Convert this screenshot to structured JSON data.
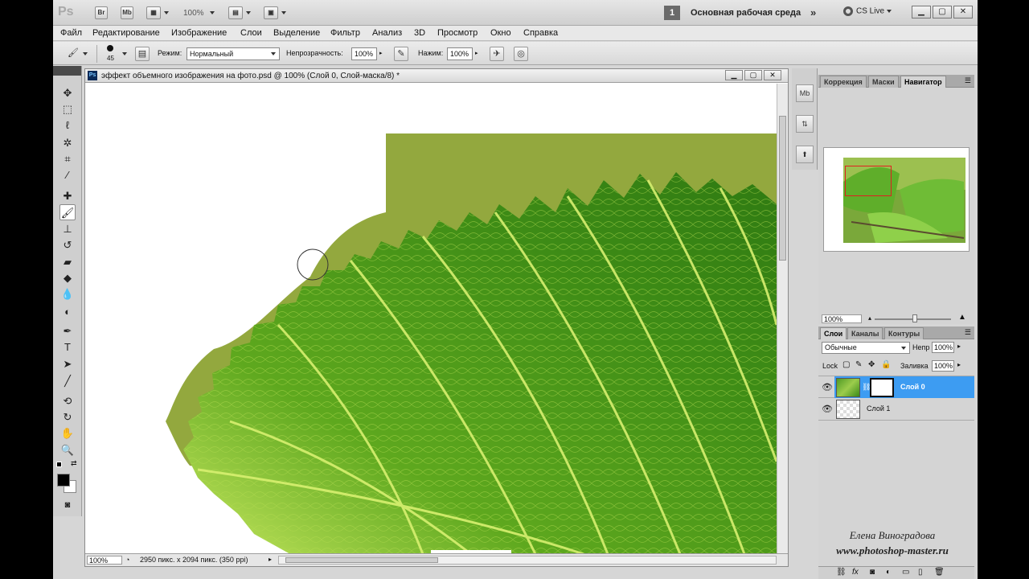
{
  "app": {
    "logo": "Ps",
    "bridge_btn": "Br",
    "minibridge_btn": "Mb",
    "zoom": "100%",
    "workspace_number": "1",
    "workspace": "Основная рабочая среда",
    "cs_live": "CS Live"
  },
  "menu": [
    "Файл",
    "Редактирование",
    "Изображение",
    "Слои",
    "Выделение",
    "Фильтр",
    "Анализ",
    "3D",
    "Просмотр",
    "Окно",
    "Справка"
  ],
  "options": {
    "brush_size": "45",
    "mode_label": "Режим:",
    "mode_value": "Нормальный",
    "opacity_label": "Непрозрачность:",
    "opacity_value": "100%",
    "flow_label": "Нажим:",
    "flow_value": "100%"
  },
  "document": {
    "title": "эффект объемного изображения на фото.psd @ 100% (Слой 0, Слой-маска/8) *",
    "zoom": "100%",
    "info": "2950 пикс. x 2094 пикс. (350 ppi)"
  },
  "panel_icons": [
    "Mb",
    "",
    ""
  ],
  "navigator": {
    "tabs": [
      "Коррекция",
      "Маски",
      "Навигатор"
    ],
    "active_tab": "Навигатор",
    "zoom": "100%"
  },
  "layers": {
    "tabs": [
      "Слои",
      "Каналы",
      "Контуры"
    ],
    "active_tab": "Слои",
    "blend_mode": "Обычные",
    "opacity_label": "Непр",
    "opacity_value": "100%",
    "lock_label": "Lock",
    "fill_label": "Заливка",
    "fill_value": "100%",
    "items": [
      {
        "name": "Слой 0",
        "selected": true
      },
      {
        "name": "Слой 1",
        "selected": false
      }
    ]
  },
  "watermark": {
    "name": "Елена Виноградова",
    "url": "www.photoshop-master.ru"
  },
  "colors": {
    "leaf_dark": "#2f7a12",
    "leaf_light": "#c8e860",
    "bg_olive": "#93a83e",
    "selection": "#3d9cf2"
  }
}
